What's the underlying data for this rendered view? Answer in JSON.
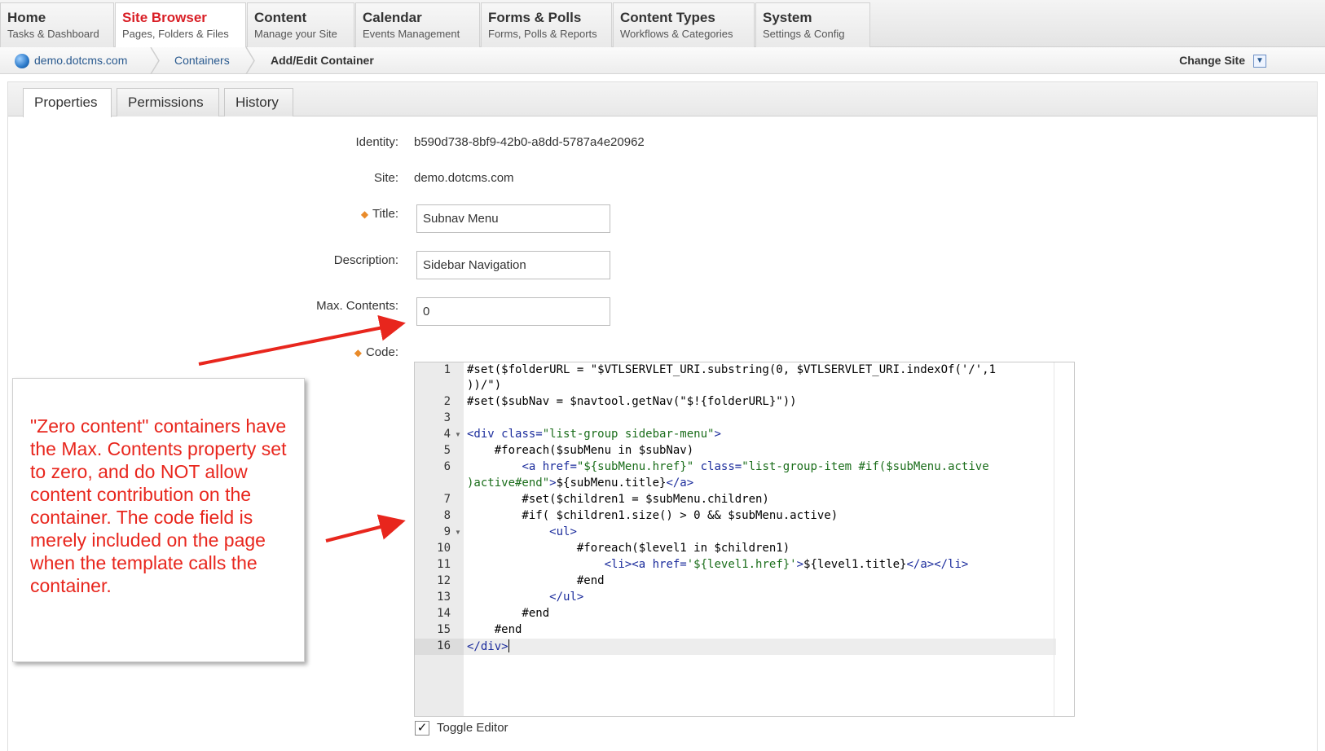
{
  "topnav": [
    {
      "title": "Home",
      "subtitle": "Tasks & Dashboard"
    },
    {
      "title": "Site Browser",
      "subtitle": "Pages, Folders & Files"
    },
    {
      "title": "Content",
      "subtitle": "Manage your Site"
    },
    {
      "title": "Calendar",
      "subtitle": "Events Management"
    },
    {
      "title": "Forms & Polls",
      "subtitle": "Forms, Polls & Reports"
    },
    {
      "title": "Content Types",
      "subtitle": "Workflows & Categories"
    },
    {
      "title": "System",
      "subtitle": "Settings & Config"
    }
  ],
  "breadcrumb": {
    "site": "demo.dotcms.com",
    "section": "Containers",
    "current": "Add/Edit Container"
  },
  "change_site": {
    "label": "Change Site",
    "icon": "chevron-down-icon"
  },
  "tabs": [
    "Properties",
    "Permissions",
    "History"
  ],
  "form": {
    "identity": {
      "label": "Identity:",
      "value": "b590d738-8bf9-42b0-a8dd-5787a4e20962"
    },
    "site": {
      "label": "Site:",
      "value": "demo.dotcms.com"
    },
    "title": {
      "label": "Title:",
      "value": "Subnav Menu"
    },
    "description": {
      "label": "Description:",
      "value": "Sidebar Navigation"
    },
    "max_contents": {
      "label": "Max. Contents:",
      "value": "0"
    },
    "code": {
      "label": "Code:"
    }
  },
  "editor": {
    "line_numbers": [
      "1",
      "2",
      "3",
      "4",
      "5",
      "6",
      "7",
      "8",
      "9",
      "10",
      "11",
      "12",
      "13",
      "14",
      "15",
      "16"
    ],
    "current_line": 16
  },
  "toggle_editor": {
    "label": "Toggle Editor",
    "checked": true
  },
  "annotation": {
    "text": "\"Zero content\" containers have the Max. Contents property set to zero, and do NOT allow content contribution on the container. The code field is merely included on the page when the template calls the container.",
    "color": "#e8261d"
  },
  "colors": {
    "active_tab": "#d91f26",
    "link": "#2a5a8f",
    "required_marker": "#e98b2a"
  }
}
